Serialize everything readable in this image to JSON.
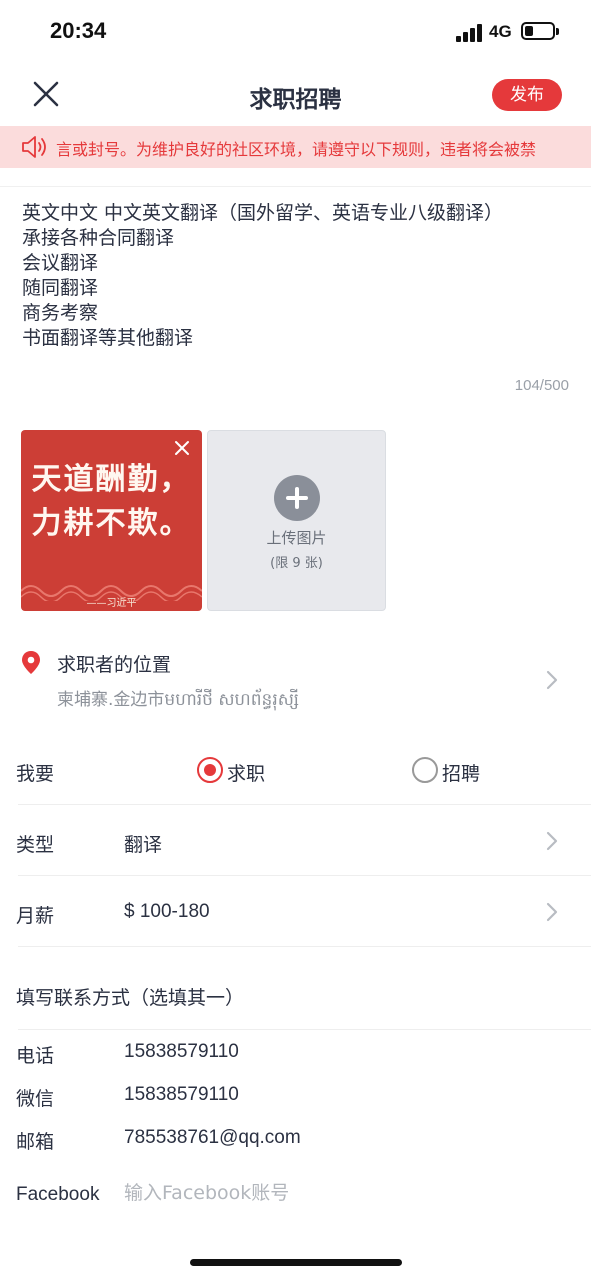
{
  "status_bar": {
    "time": "20:34",
    "network": "4G",
    "battery_level": 0.3
  },
  "nav": {
    "title": "求职招聘",
    "publish_label": "发布"
  },
  "notice": {
    "text": "言或封号。为维护良好的社区环境，请遵守以下规则，违者将会被禁"
  },
  "description": {
    "text": "英文中文 中文英文翻译（国外留学、英语专业八级翻译）\n承接各种合同翻译\n会议翻译\n随同翻译\n商务考察\n书面翻译等其他翻译",
    "counter": "104/500"
  },
  "images": {
    "thumbnail": {
      "line1": "天道酬勤，",
      "line2": "力耕不欺。",
      "signature": "——习近平"
    },
    "upload_label": "上传图片",
    "upload_limit": "(限 9 张)"
  },
  "location": {
    "title": "求职者的位置",
    "value": "柬埔寨.金边市មហារីថី សហព័ន្ធរុស្សី"
  },
  "intent": {
    "label": "我要",
    "options": [
      {
        "label": "求职",
        "selected": true
      },
      {
        "label": "招聘",
        "selected": false
      }
    ]
  },
  "category": {
    "label": "类型",
    "value": "翻译"
  },
  "salary": {
    "label": "月薪",
    "value": "$ 100-180"
  },
  "contact": {
    "section_title": "填写联系方式（选填其一）",
    "phone": {
      "label": "电话",
      "value": "15838579110"
    },
    "wechat": {
      "label": "微信",
      "value": "15838579110"
    },
    "email": {
      "label": "邮箱",
      "value": "785538761@qq.com"
    },
    "facebook": {
      "label": "Facebook",
      "value": "",
      "placeholder": "输入Facebook账号"
    }
  },
  "colors": {
    "accent": "#e5393b",
    "notice_bg": "#fbdcdc",
    "text": "#2b3142",
    "muted": "#8d929a"
  }
}
